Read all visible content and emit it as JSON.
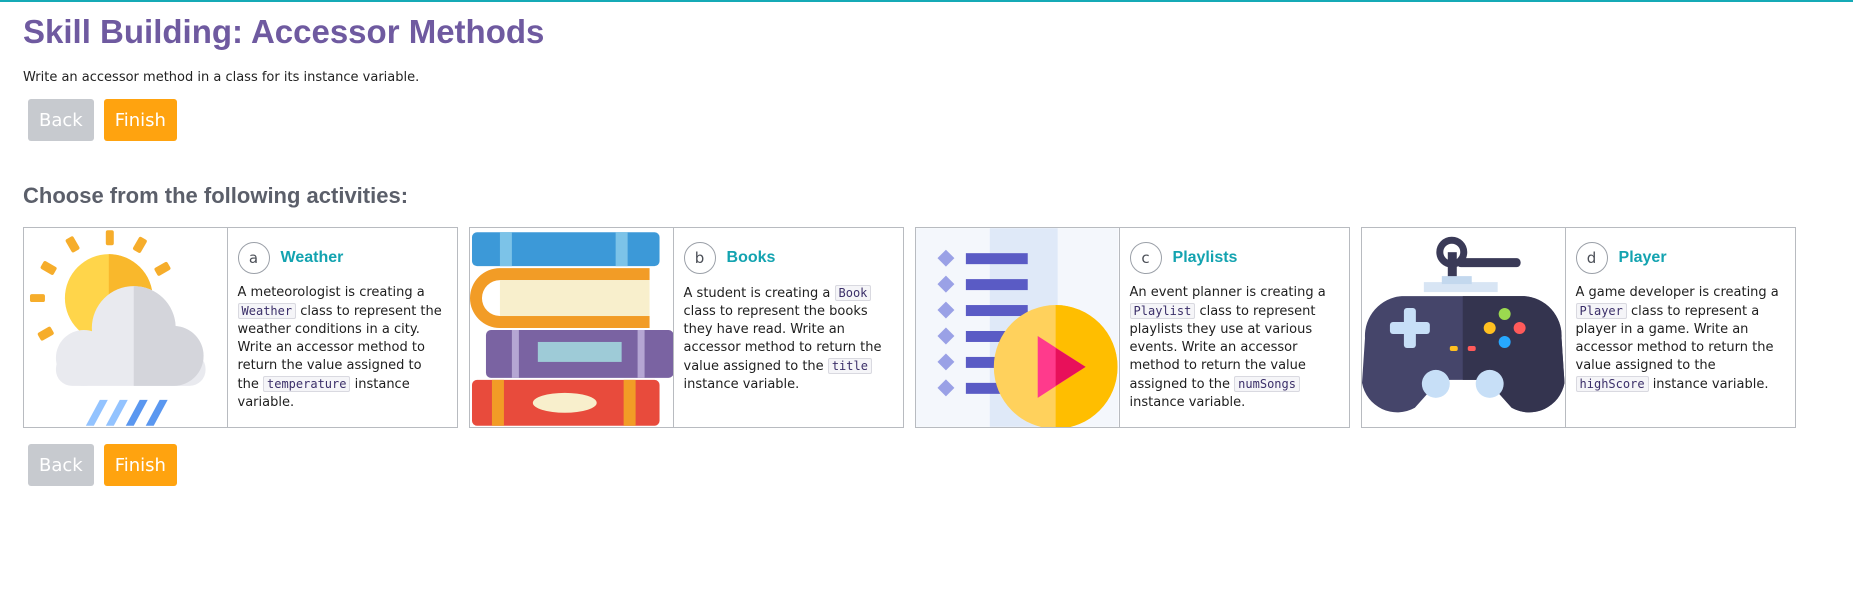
{
  "page": {
    "title": "Skill Building: Accessor Methods",
    "subtitle": "Write an accessor method in a class for its instance variable.",
    "section_title": "Choose from the following activities:"
  },
  "buttons": {
    "back_label": "Back",
    "finish_label": "Finish"
  },
  "colors": {
    "title": "#6f5aa0",
    "accent": "#13a3b0",
    "finish": "#ffa30f",
    "back": "#c7cacf"
  },
  "activities": [
    {
      "letter": "a",
      "name": "Weather",
      "icon": "weather-icon",
      "p1": "A meteorologist is creating a",
      "code1": "Weather",
      "p2": "class to represent the weather conditions in a city. Write an accessor method to return the value assigned to the",
      "code2": "temperature",
      "p3": "instance variable."
    },
    {
      "letter": "b",
      "name": "Books",
      "icon": "books-icon",
      "p1": "A student is creating a",
      "code1": "Book",
      "p2": "class to represent the books they have read. Write an accessor method to return the value assigned to the",
      "code2": "title",
      "p3": "instance variable."
    },
    {
      "letter": "c",
      "name": "Playlists",
      "icon": "playlist-icon",
      "p1": "An event planner is creating a",
      "code1": "Playlist",
      "p2": "class to represent playlists they use at various events. Write an accessor method to return the value assigned to the",
      "code2": "numSongs",
      "p3": "instance variable."
    },
    {
      "letter": "d",
      "name": "Player",
      "icon": "game-controller-icon",
      "p1": "A game developer is creating a",
      "code1": "Player",
      "p2": "class to represent a player in a game. Write an accessor method to return the value assigned to the",
      "code2": "highScore",
      "p3": "instance variable."
    }
  ]
}
